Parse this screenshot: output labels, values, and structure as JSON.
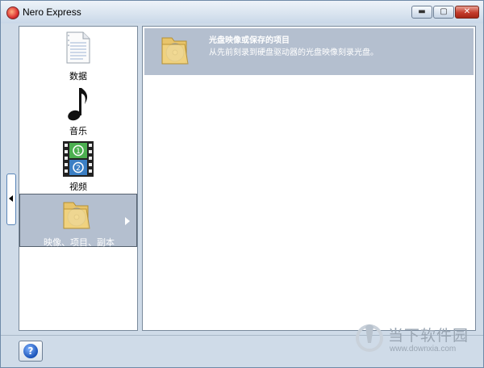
{
  "window": {
    "title": "Nero Express",
    "icon": "nero-app-icon",
    "controls": {
      "minimize": "▬",
      "maximize": "▢",
      "close": "✕"
    }
  },
  "categories": [
    {
      "label": "数据",
      "icon": "document-icon",
      "selected": false
    },
    {
      "label": "音乐",
      "icon": "music-note-icon",
      "selected": false
    },
    {
      "label": "视频",
      "icon": "film-icon",
      "selected": false
    },
    {
      "label": "映像、项目、副本",
      "icon": "folder-disc-icon",
      "selected": true
    }
  ],
  "main": {
    "items": [
      {
        "title": "光盘映像或保存的项目",
        "description": "从先前刻录到硬盘驱动器的光盘映像刻录光盘。",
        "icon": "folder-disc-icon"
      }
    ]
  },
  "footer": {
    "help_label": "?"
  },
  "watermark": {
    "name": "当下软件园",
    "url": "www.downxia.com"
  },
  "colors": {
    "selection": "#b4bfcf",
    "window_frame": "#cfdbe8"
  }
}
